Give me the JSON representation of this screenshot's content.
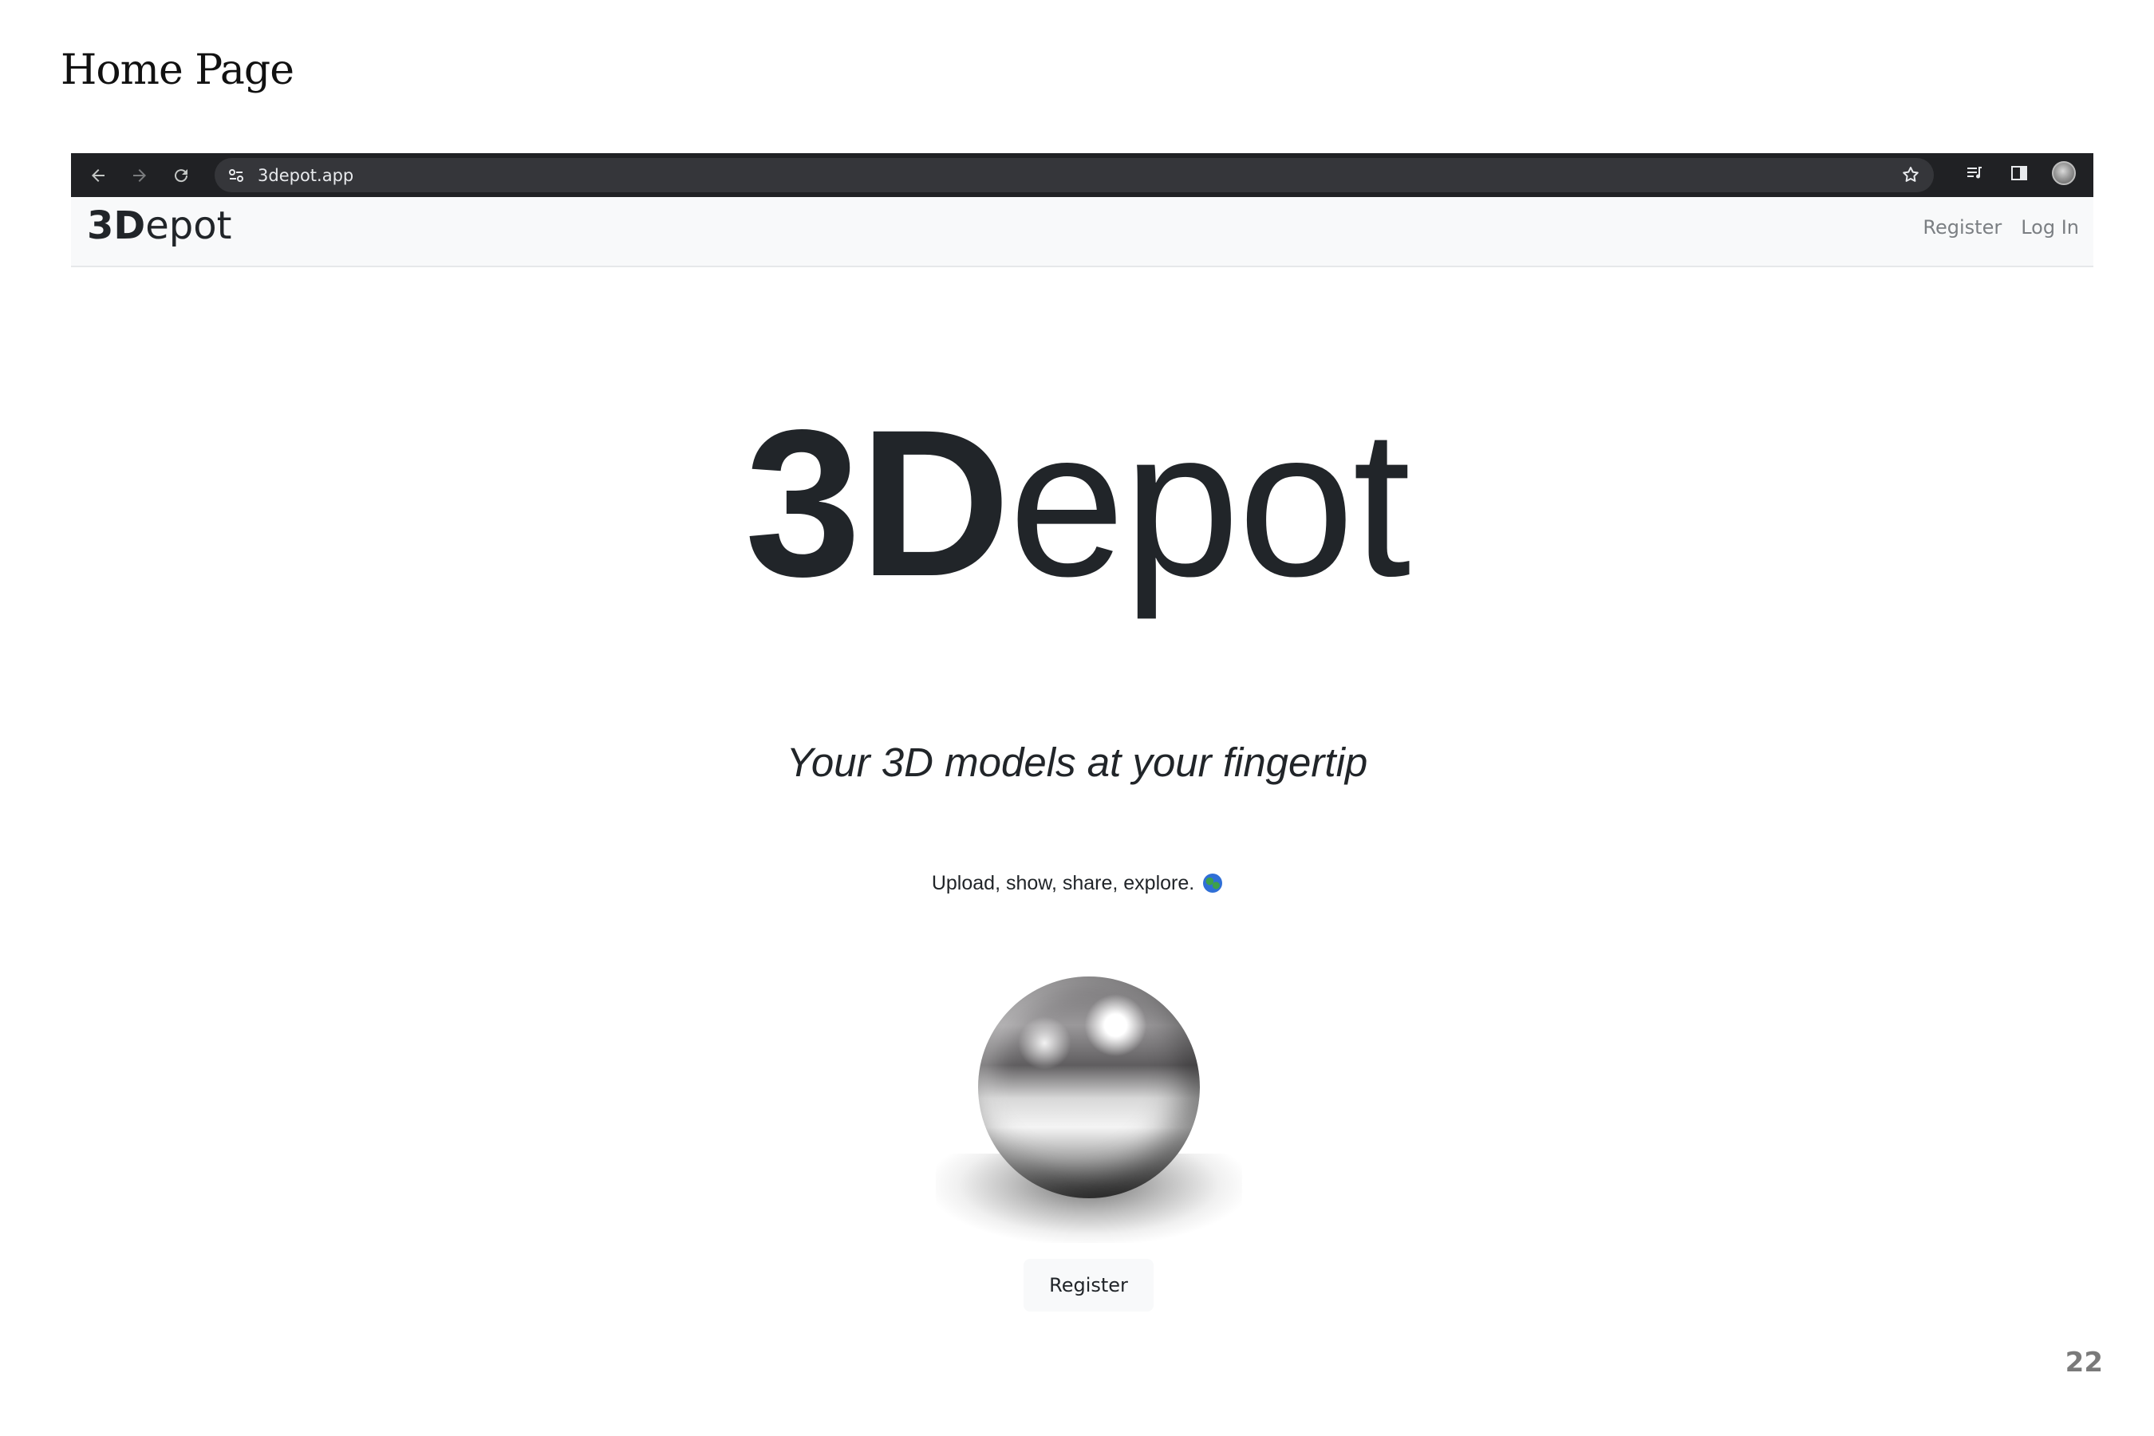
{
  "slide": {
    "title": "Home Page",
    "page_number": "22"
  },
  "browser": {
    "url": "3depot.app",
    "icons": [
      "back-arrow-icon",
      "forward-arrow-icon",
      "reload-icon",
      "site-info-icon",
      "star-icon",
      "media-playlist-icon",
      "side-panel-icon",
      "profile-avatar-icon"
    ]
  },
  "navbar": {
    "brand_bold": "3D",
    "brand_rest": "epot",
    "links": {
      "register": "Register",
      "login": "Log In"
    }
  },
  "hero": {
    "title_bold": "3D",
    "title_rest": "epot",
    "tagline": "Your 3D models at your fingertip",
    "subtext": "Upload, show, share, explore.",
    "subtext_emoji": "globe-icon",
    "cta_label": "Register"
  },
  "colors": {
    "chrome_bar": "#202124",
    "omnibox": "#35363a",
    "navbar_bg": "#f8f9fa",
    "text": "#212529",
    "nav_link": "#7b7f83"
  }
}
